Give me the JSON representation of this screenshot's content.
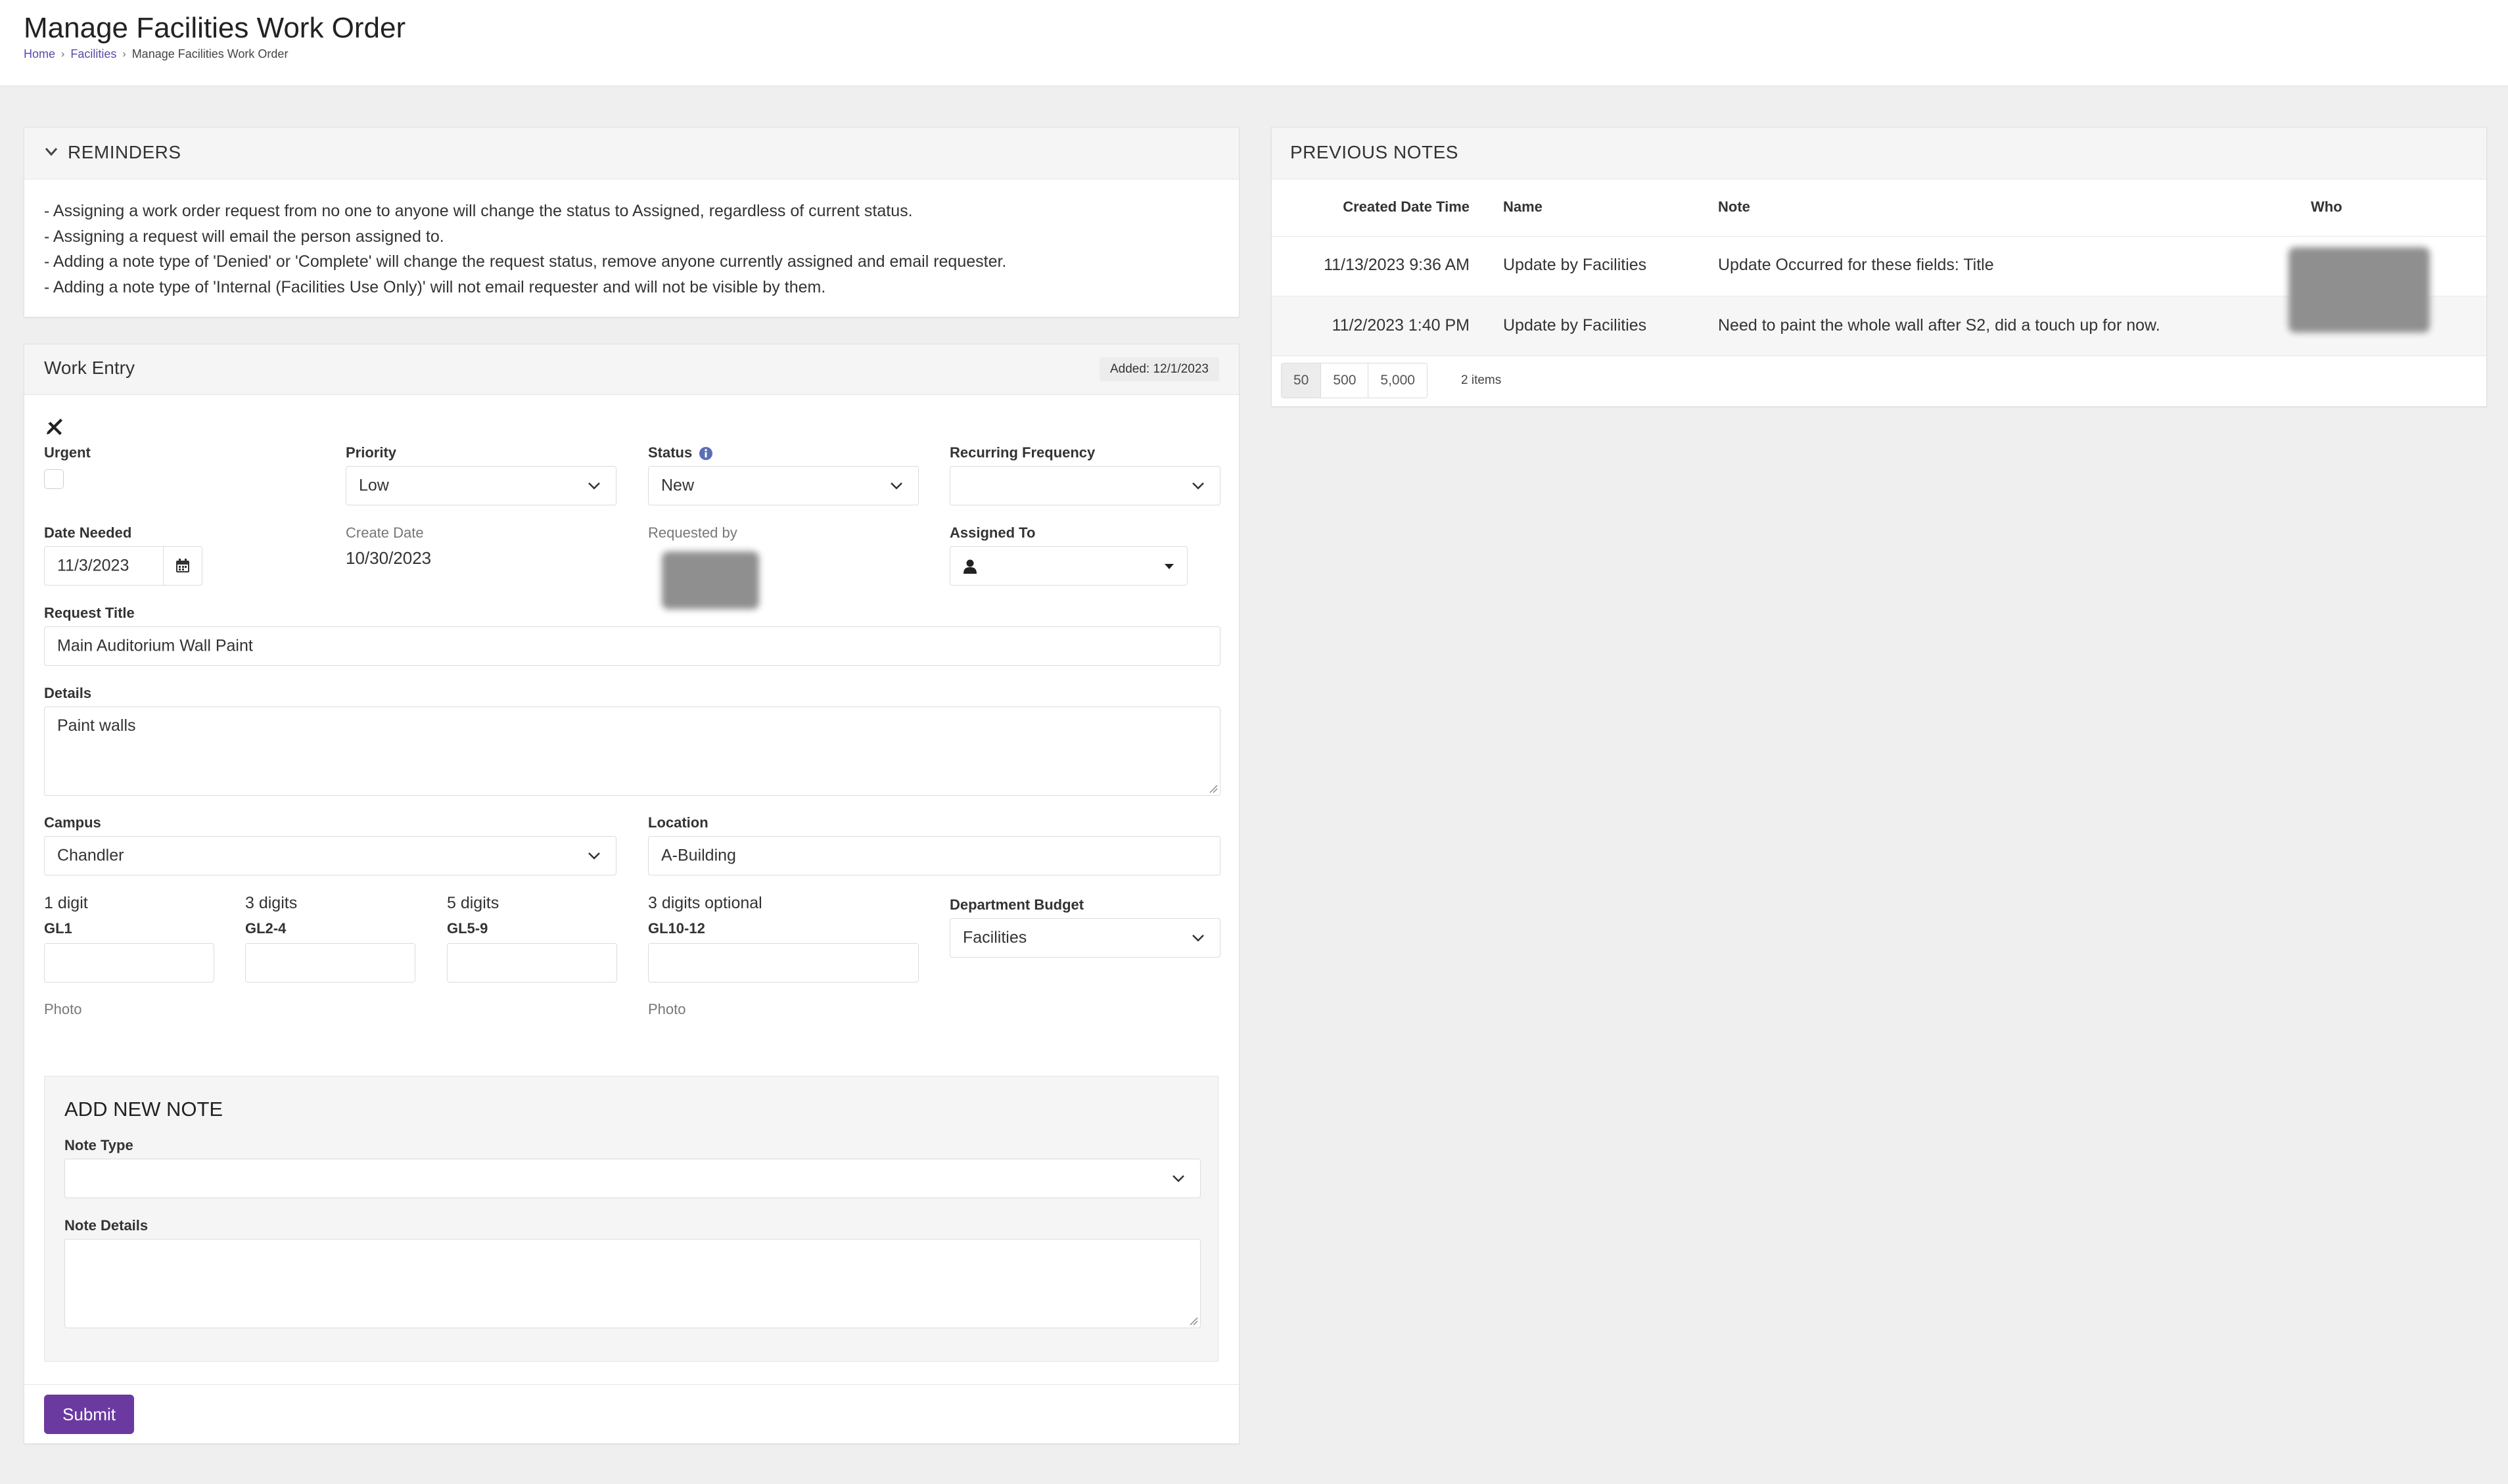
{
  "header": {
    "title": "Manage Facilities Work Order",
    "breadcrumb": [
      "Home",
      "Facilities",
      "Manage Facilities Work Order"
    ]
  },
  "reminders": {
    "title": "REMINDERS",
    "items": [
      "- Assigning a work order request from no one to anyone will change the status to Assigned, regardless of current status.",
      "- Assigning a request will email the person assigned to.",
      "- Adding a note type of 'Denied' or 'Complete' will change the request status, remove anyone currently assigned and email requester.",
      "- Adding a note type of 'Internal (Facilities Use Only)' will not email requester and will not be visible by them."
    ]
  },
  "work_entry": {
    "title": "Work Entry",
    "added_badge": "Added: 12/1/2023",
    "urgent_label": "Urgent",
    "urgent_checked": false,
    "priority_label": "Priority",
    "priority_value": "Low",
    "status_label": "Status",
    "status_value": "New",
    "recurring_label": "Recurring Frequency",
    "recurring_value": "",
    "date_needed_label": "Date Needed",
    "date_needed_value": "11/3/2023",
    "create_date_label": "Create Date",
    "create_date_value": "10/30/2023",
    "requested_by_label": "Requested by",
    "assigned_to_label": "Assigned To",
    "assigned_to_value": "",
    "request_title_label": "Request Title",
    "request_title_value": "Main Auditorium Wall Paint",
    "details_label": "Details",
    "details_value": "Paint walls",
    "campus_label": "Campus",
    "campus_value": "Chandler",
    "location_label": "Location",
    "location_value": "A-Building",
    "gl_fields": [
      {
        "hint": "1 digit",
        "label": "GL1",
        "value": ""
      },
      {
        "hint": "3 digits",
        "label": "GL2-4",
        "value": ""
      },
      {
        "hint": "5 digits",
        "label": "GL5-9",
        "value": ""
      },
      {
        "hint": "3 digits optional",
        "label": "GL10-12",
        "value": ""
      }
    ],
    "department_budget_label": "Department Budget",
    "department_budget_value": "Facilities",
    "photo_label_1": "Photo",
    "photo_label_2": "Photo",
    "submit_label": "Submit"
  },
  "add_note": {
    "title": "ADD NEW NOTE",
    "note_type_label": "Note Type",
    "note_type_value": "",
    "note_details_label": "Note Details",
    "note_details_value": ""
  },
  "previous_notes": {
    "title": "PREVIOUS NOTES",
    "columns": [
      "Created Date Time",
      "Name",
      "Note",
      "Who"
    ],
    "rows": [
      {
        "created": "11/13/2023 9:36 AM",
        "name": "Update by Facilities",
        "note": "Update Occurred for these fields: Title"
      },
      {
        "created": "11/2/2023 1:40 PM",
        "name": "Update by Facilities",
        "note": "Need to paint the whole wall after S2, did a touch up for now."
      }
    ],
    "page_sizes": [
      "50",
      "500",
      "5,000"
    ],
    "active_page_size": "50",
    "items_count": "2 items"
  },
  "colors": {
    "background": "#efefef",
    "panel_header": "#f5f5f5",
    "submit_button": "#6b3aa0",
    "breadcrumb_link": "#5a4aa8",
    "info_icon": "#5b6fb5"
  },
  "icons": {
    "reminders_toggle": "chevron-down-icon",
    "work_entry": "tools-icon",
    "status_info": "info-icon",
    "calendar": "calendar-icon",
    "assignee": "user-icon",
    "select_caret": "chevron-down-icon"
  }
}
